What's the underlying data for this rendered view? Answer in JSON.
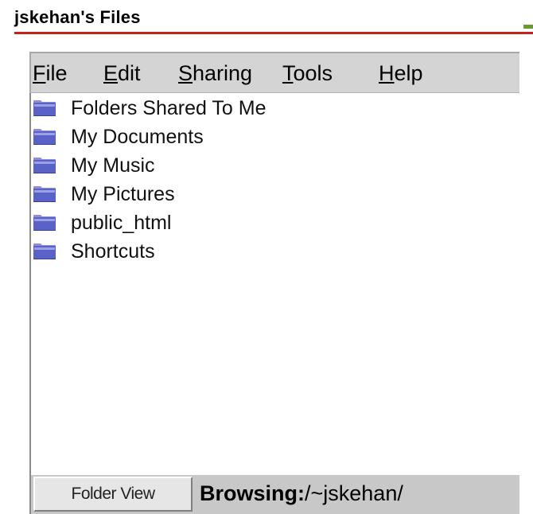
{
  "header": {
    "title": "jskehan's Files"
  },
  "menubar": {
    "items": [
      {
        "acc": "F",
        "rest": "ile"
      },
      {
        "acc": "E",
        "rest": "dit"
      },
      {
        "acc": "S",
        "rest": "haring"
      },
      {
        "acc": "T",
        "rest": "ools"
      },
      {
        "acc": "H",
        "rest": "elp"
      }
    ]
  },
  "files": [
    {
      "name": "Folders Shared To Me",
      "icon": "folder-icon"
    },
    {
      "name": "My Documents",
      "icon": "folder-icon"
    },
    {
      "name": "My Music",
      "icon": "folder-icon"
    },
    {
      "name": "My Pictures",
      "icon": "folder-icon"
    },
    {
      "name": "public_html",
      "icon": "folder-icon"
    },
    {
      "name": "Shortcuts",
      "icon": "folder-icon"
    }
  ],
  "statusbar": {
    "folder_view_label": "Folder View",
    "browsing_label": "Browsing:",
    "path": "/~jskehan/"
  },
  "colors": {
    "header_rule": "#c8201a",
    "minimize": "#6a9a2a",
    "menubar_bg": "#d4d4d4",
    "folder": "#5a62c8"
  }
}
